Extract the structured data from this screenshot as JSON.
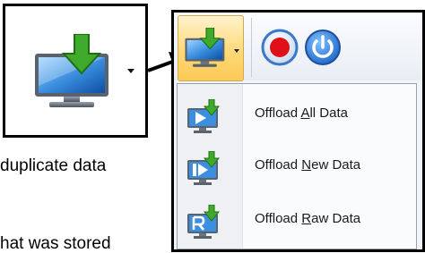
{
  "callout": {
    "icon": "monitor-download-icon",
    "caret_icon": "dropdown-caret-icon"
  },
  "document_text": {
    "line1": "duplicate data",
    "line2": "hat was stored"
  },
  "toolbar": {
    "offload_button_icon": "monitor-download-icon",
    "record_button_icon": "record-icon",
    "power_button_icon": "power-icon"
  },
  "menu": {
    "items": [
      {
        "pre": "Offload ",
        "accel": "A",
        "post": "ll Data",
        "icon": "offload-all-icon"
      },
      {
        "pre": "Offload ",
        "accel": "N",
        "post": "ew Data",
        "icon": "offload-new-icon"
      },
      {
        "pre": "Offload ",
        "accel": "R",
        "post": "aw Data",
        "icon": "offload-raw-icon"
      }
    ]
  },
  "colors": {
    "record_red": "#e0101a",
    "power_blue": "#1f7be0",
    "download_green": "#3faa2c",
    "hover_orange": "#ffd978"
  }
}
